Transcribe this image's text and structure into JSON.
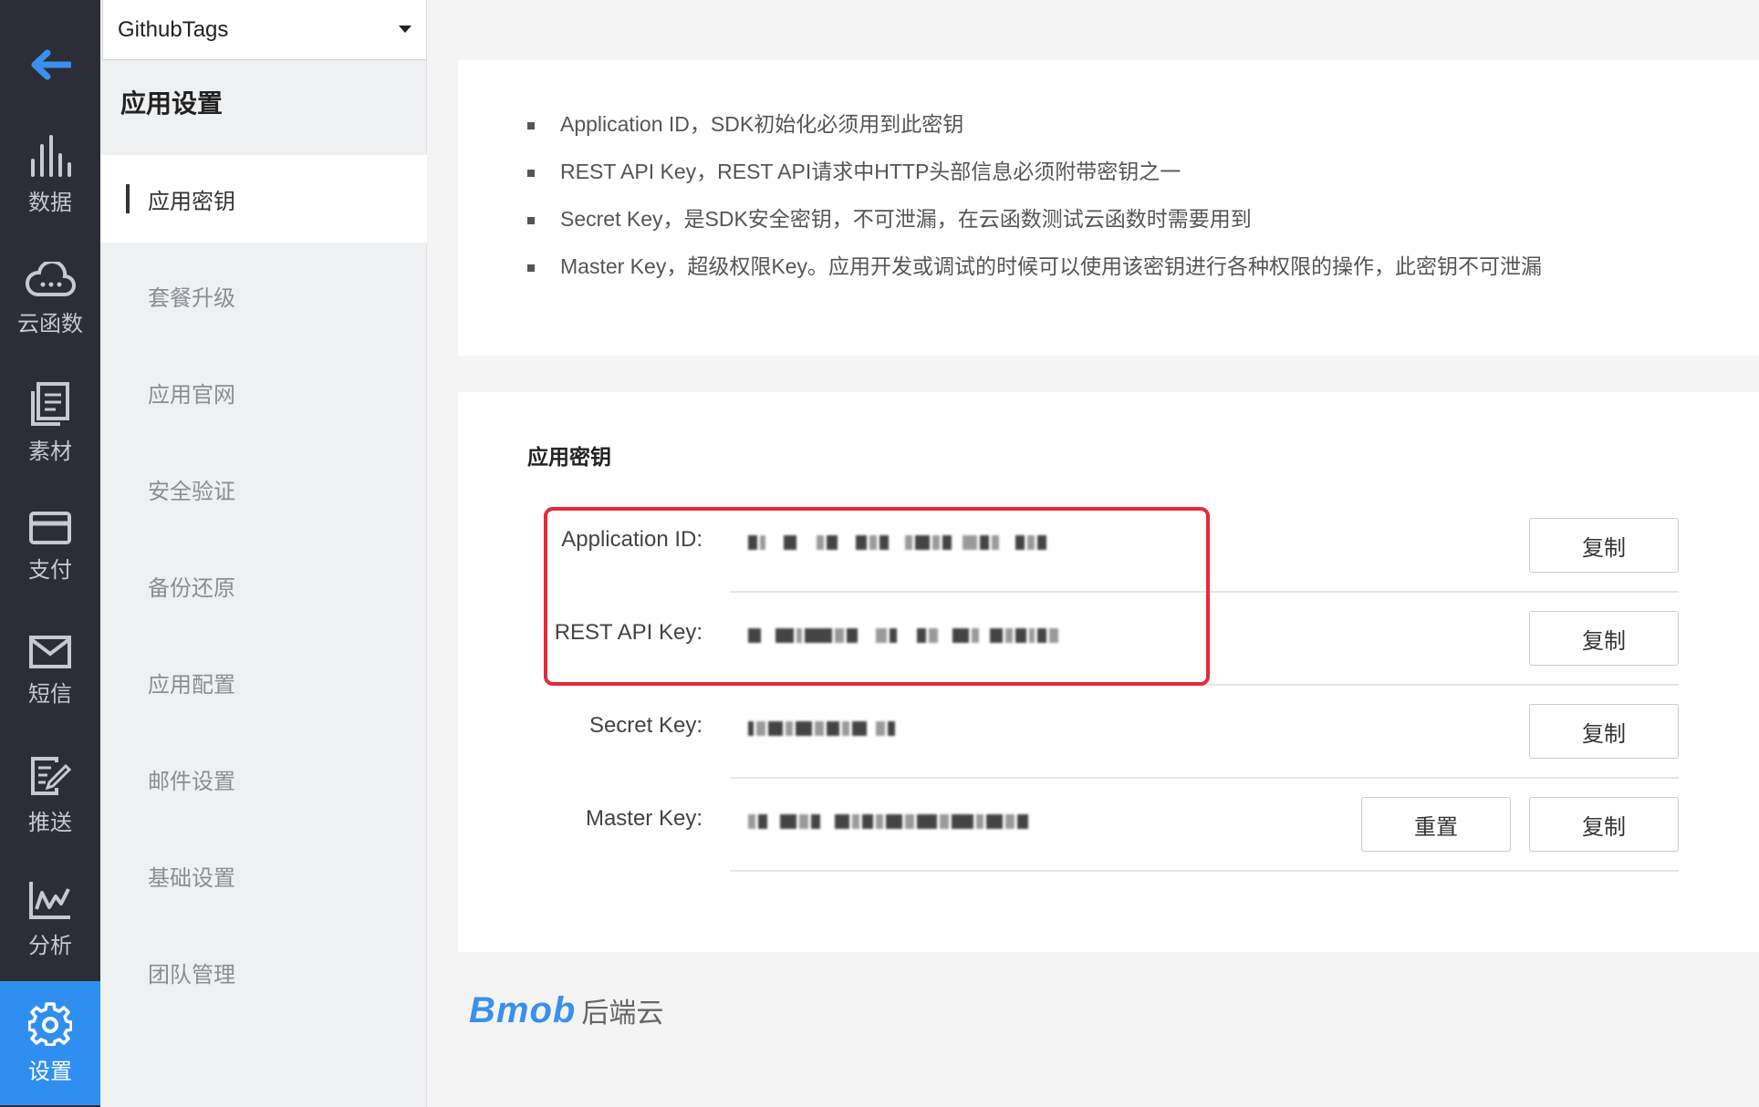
{
  "app_selector": {
    "value": "GithubTags"
  },
  "rail": {
    "items": [
      {
        "label": "数据",
        "icon": "bar-chart-icon"
      },
      {
        "label": "云函数",
        "icon": "cloud-icon"
      },
      {
        "label": "素材",
        "icon": "document-icon"
      },
      {
        "label": "支付",
        "icon": "card-icon"
      },
      {
        "label": "短信",
        "icon": "mail-icon"
      },
      {
        "label": "推送",
        "icon": "push-icon"
      },
      {
        "label": "分析",
        "icon": "line-chart-icon"
      },
      {
        "label": "设置",
        "icon": "gear-icon"
      }
    ],
    "active_color": "#2f8ff0"
  },
  "sidebar": {
    "title": "应用设置",
    "items": [
      {
        "label": "应用密钥"
      },
      {
        "label": "套餐升级"
      },
      {
        "label": "应用官网"
      },
      {
        "label": "安全验证"
      },
      {
        "label": "备份还原"
      },
      {
        "label": "应用配置"
      },
      {
        "label": "邮件设置"
      },
      {
        "label": "基础设置"
      },
      {
        "label": "团队管理"
      }
    ]
  },
  "info": {
    "bullets": [
      "Application ID，SDK初始化必须用到此密钥",
      "REST API Key，REST API请求中HTTP头部信息必须附带密钥之一",
      "Secret Key，是SDK安全密钥，不可泄漏，在云函数测试云函数时需要用到",
      "Master Key，超级权限Key。应用开发或调试的时候可以使用该密钥进行各种权限的操作，此密钥不可泄漏"
    ]
  },
  "keys": {
    "title": "应用密钥",
    "rows": [
      {
        "label": "Application ID:",
        "copy": "复制"
      },
      {
        "label": "REST API Key:",
        "copy": "复制"
      },
      {
        "label": "Secret Key:",
        "copy": "复制"
      },
      {
        "label": "Master Key:",
        "copy": "复制",
        "reset": "重置"
      }
    ],
    "highlight_color": "#e8293a"
  },
  "footer": {
    "brand": "Bmob",
    "brand_suffix": "后端云",
    "brand_color": "#3a8ff0"
  }
}
